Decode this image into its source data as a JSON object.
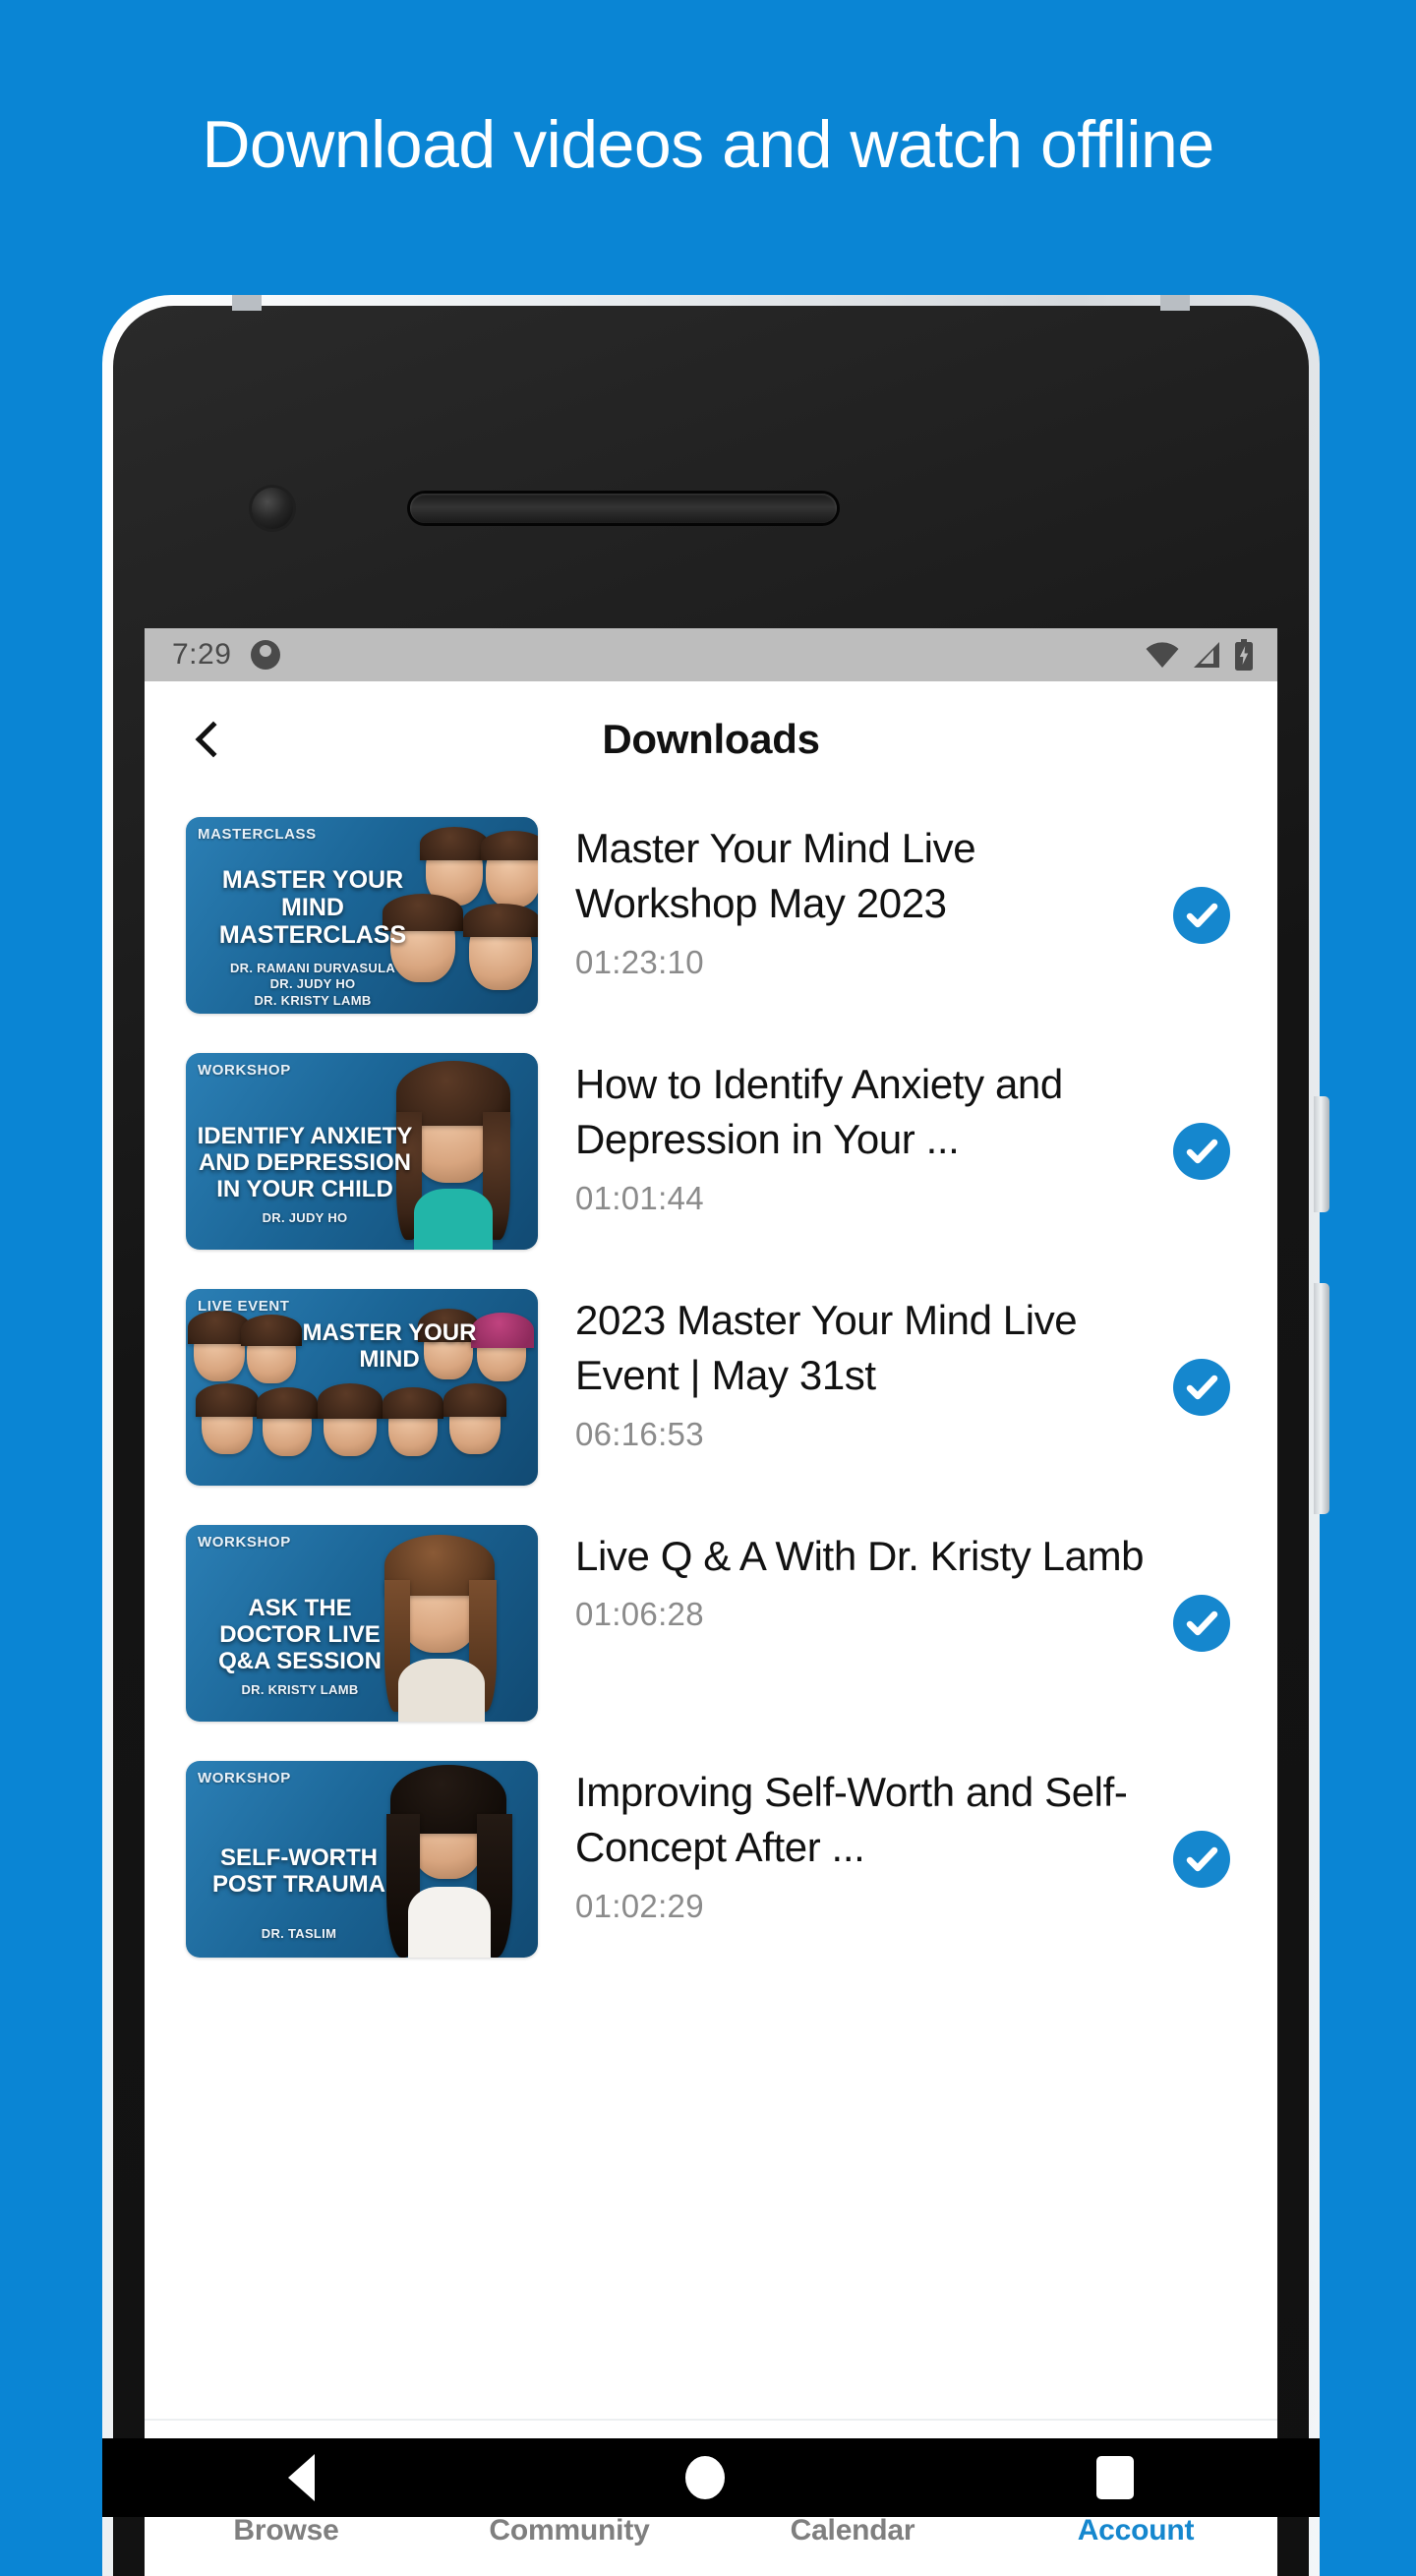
{
  "promo": {
    "headline": "Download videos and watch offline",
    "background_color": "#0a85d4"
  },
  "status_bar": {
    "time": "7:29",
    "icons": [
      "notification-dot-icon",
      "wifi-icon",
      "cellular-signal-icon",
      "battery-charging-icon"
    ]
  },
  "app_bar": {
    "back_icon": "chevron-left-icon",
    "title": "Downloads"
  },
  "downloads": {
    "items": [
      {
        "title": "Master Your Mind Live Workshop May 2023",
        "duration": "01:23:10",
        "downloaded": true,
        "thumbnail": {
          "tag": "MASTERCLASS",
          "headline": "MASTER YOUR MIND MASTERCLASS",
          "byline": "DR. RAMANI DURVASULA\nDR. JUDY HO\nDR. KRISTY LAMB"
        }
      },
      {
        "title": "How to Identify Anxiety and Depression in Your ...",
        "duration": "01:01:44",
        "downloaded": true,
        "thumbnail": {
          "tag": "WORKSHOP",
          "headline": "IDENTIFY ANXIETY AND DEPRESSION IN YOUR CHILD",
          "byline": "DR. JUDY HO"
        }
      },
      {
        "title": "2023 Master Your Mind Live Event | May 31st",
        "duration": "06:16:53",
        "downloaded": true,
        "thumbnail": {
          "tag": "LIVE EVENT",
          "headline": "MASTER YOUR MIND",
          "byline": ""
        }
      },
      {
        "title": "Live Q & A With Dr. Kristy Lamb",
        "duration": "01:06:28",
        "downloaded": true,
        "thumbnail": {
          "tag": "WORKSHOP",
          "headline": "ASK THE DOCTOR LIVE Q&A SESSION",
          "byline": "DR. KRISTY LAMB"
        }
      },
      {
        "title": "Improving Self-Worth and Self-Concept After ...",
        "duration": "01:02:29",
        "downloaded": true,
        "thumbnail": {
          "tag": "WORKSHOP",
          "headline": "SELF-WORTH POST TRAUMA",
          "byline": "DR. TASLIM"
        }
      }
    ],
    "check_icon": "check-circle-icon",
    "check_color": "#1587ce"
  },
  "bottom_nav": {
    "active_color": "#1587ce",
    "inactive_color": "#7f7f7f",
    "items": [
      {
        "label": "Browse",
        "icon": "play-circle-icon",
        "active": false
      },
      {
        "label": "Community",
        "icon": "people-icon",
        "active": false
      },
      {
        "label": "Calendar",
        "icon": "calendar-icon",
        "active": false
      },
      {
        "label": "Account",
        "icon": "account-card-icon",
        "active": true
      }
    ]
  },
  "android_nav": {
    "back": "android-back-icon",
    "home": "android-home-icon",
    "recents": "android-recents-icon"
  }
}
